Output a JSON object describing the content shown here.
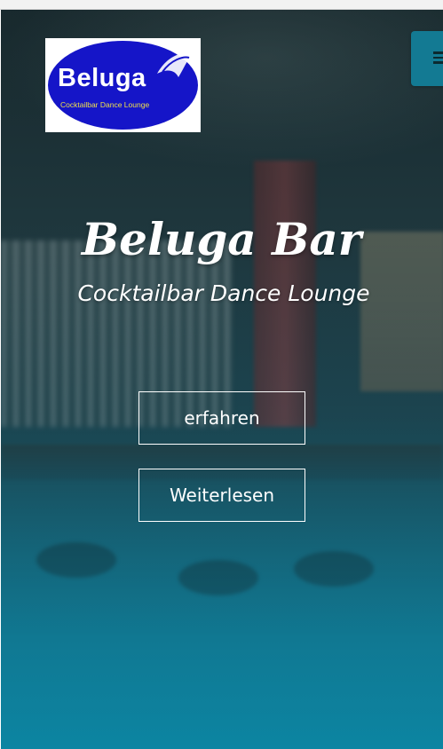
{
  "logo": {
    "name": "Beluga",
    "tagline": "Cocktailbar Dance Lounge"
  },
  "menu": {
    "icon": "hamburger-icon"
  },
  "hero": {
    "title": "Beluga Bar",
    "subtitle": "Cocktailbar Dance Lounge"
  },
  "buttons": {
    "primary_label": "erfahren",
    "secondary_label": "Weiterlesen"
  },
  "colors": {
    "accent": "#137a93",
    "logo_blue": "#1515c8",
    "logo_yellow": "#f0e04a"
  }
}
